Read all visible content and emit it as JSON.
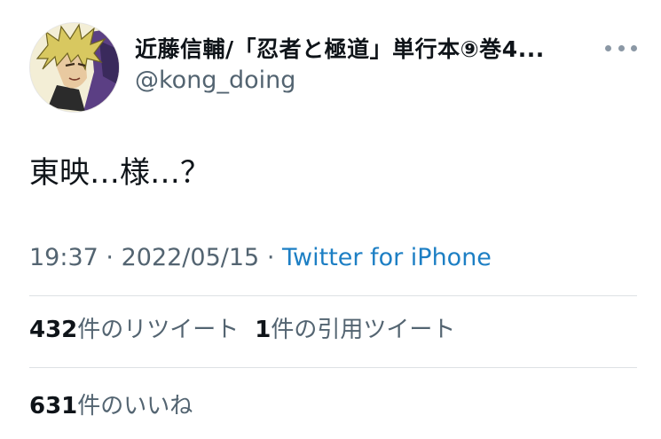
{
  "author": {
    "display_name": "近藤信輔/「忍者と極道」単行本⑨巻4...",
    "handle": "@kong_doing",
    "avatar_icon": "anime-character-avatar"
  },
  "menu": {
    "more_icon": "more-options-icon"
  },
  "tweet": {
    "text": "東映…様…？",
    "time": "19:37",
    "separator": "·",
    "date": "2022/05/15",
    "source": "Twitter for iPhone"
  },
  "stats": {
    "retweets_count": "432",
    "retweets_label": "件のリツイート",
    "quotes_count": "1",
    "quotes_label": "件の引用ツイート",
    "likes_count": "631",
    "likes_label": "件のいいね"
  },
  "colors": {
    "text": "#0f1419",
    "secondary": "#536471",
    "link": "#1d7fc4",
    "divider": "#dde1e4"
  }
}
